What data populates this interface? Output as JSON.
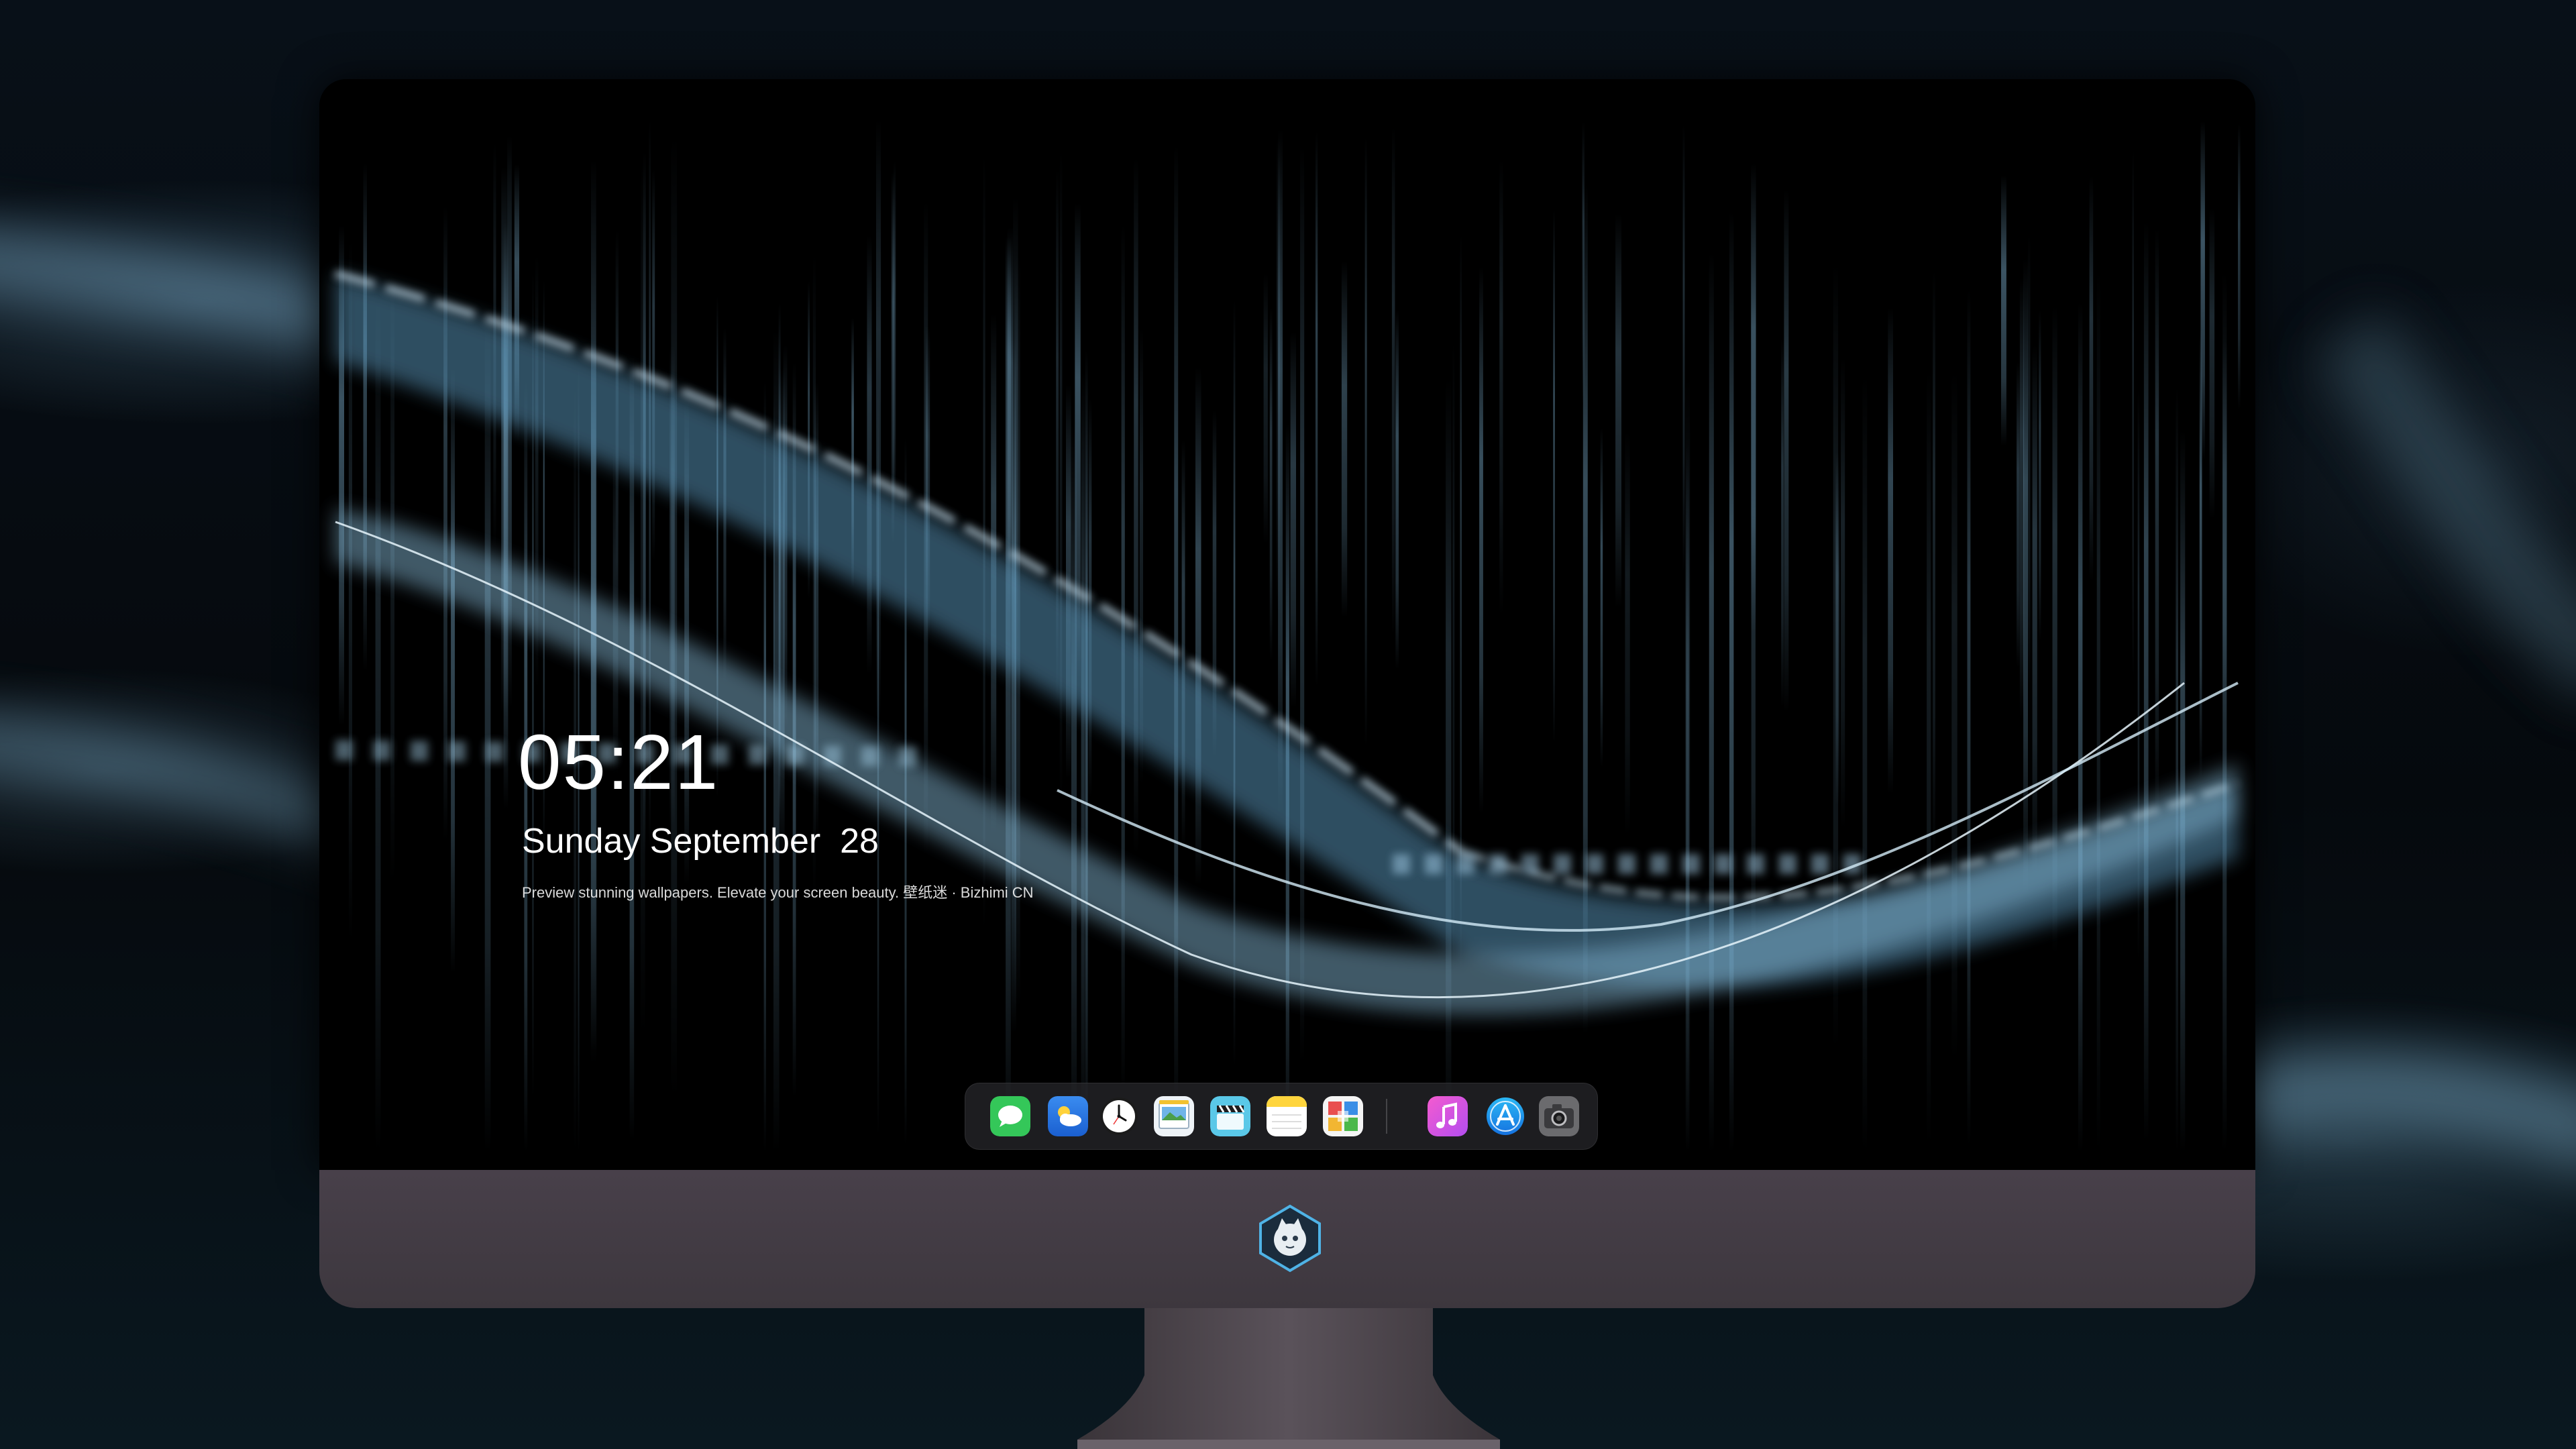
{
  "lockscreen": {
    "time": "05:21",
    "date": "Sunday September  28",
    "tagline": "Preview stunning wallpapers. Elevate your screen beauty. 壁纸迷 · Bizhimi CN"
  },
  "dock": {
    "items": [
      {
        "name": "Messages",
        "icon": "messages-icon"
      },
      {
        "name": "Weather",
        "icon": "weather-icon"
      },
      {
        "name": "Clock",
        "icon": "clock-icon"
      },
      {
        "name": "Preview",
        "icon": "preview-icon"
      },
      {
        "name": "Clips",
        "icon": "clapperboard-icon"
      },
      {
        "name": "Notes",
        "icon": "notes-icon"
      },
      {
        "name": "Photo Booth",
        "icon": "photo-grid-icon"
      },
      {
        "name": "Music",
        "icon": "music-icon"
      },
      {
        "name": "App Store",
        "icon": "app-store-icon"
      },
      {
        "name": "Screenshot",
        "icon": "camera-icon"
      }
    ]
  },
  "colors": {
    "wallpaper_accent": "#8fc6e6",
    "chin": "#433c45",
    "dock_bg": "#28282c"
  }
}
